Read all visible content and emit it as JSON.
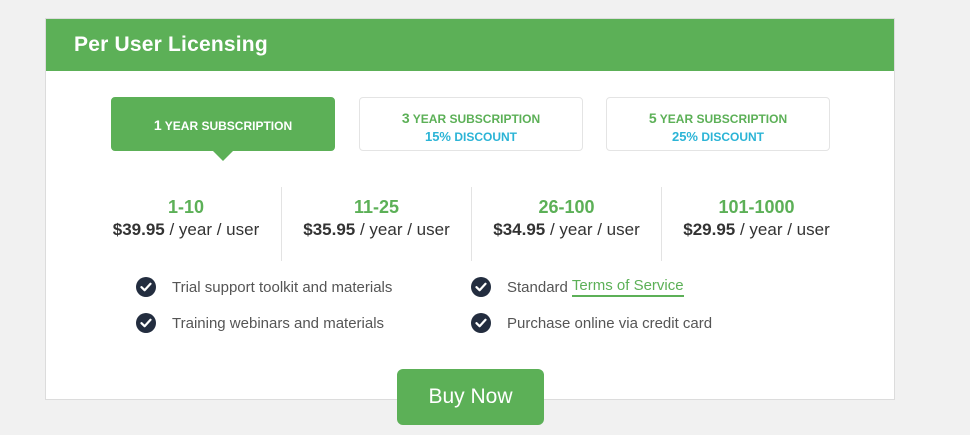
{
  "header": {
    "title": "Per User Licensing"
  },
  "plans": [
    {
      "years": "1",
      "label": "YEAR SUBSCRIPTION",
      "discount_pct": "",
      "discount_word": "",
      "active": true
    },
    {
      "years": "3",
      "label": "YEAR SUBSCRIPTION",
      "discount_pct": "15%",
      "discount_word": "DISCOUNT",
      "active": false
    },
    {
      "years": "5",
      "label": "YEAR SUBSCRIPTION",
      "discount_pct": "25%",
      "discount_word": "DISCOUNT",
      "active": false
    }
  ],
  "tiers": [
    {
      "range": "1-10",
      "price": "$39.95",
      "unit": " / year / user"
    },
    {
      "range": "11-25",
      "price": "$35.95",
      "unit": " / year / user"
    },
    {
      "range": "26-100",
      "price": "$34.95",
      "unit": " / year / user"
    },
    {
      "range": "101-1000",
      "price": "$29.95",
      "unit": " / year / user"
    }
  ],
  "features": [
    {
      "text": "Trial support toolkit and materials"
    },
    {
      "text": "Training webinars and materials"
    },
    {
      "prefix": "Standard",
      "link": "Terms of Service"
    },
    {
      "text": "Purchase online via credit card"
    }
  ],
  "buy_button": {
    "label": "Buy Now"
  },
  "colors": {
    "brand_green": "#5cb057",
    "accent_cyan": "#2bb4d6",
    "check_navy": "#232d3f"
  }
}
